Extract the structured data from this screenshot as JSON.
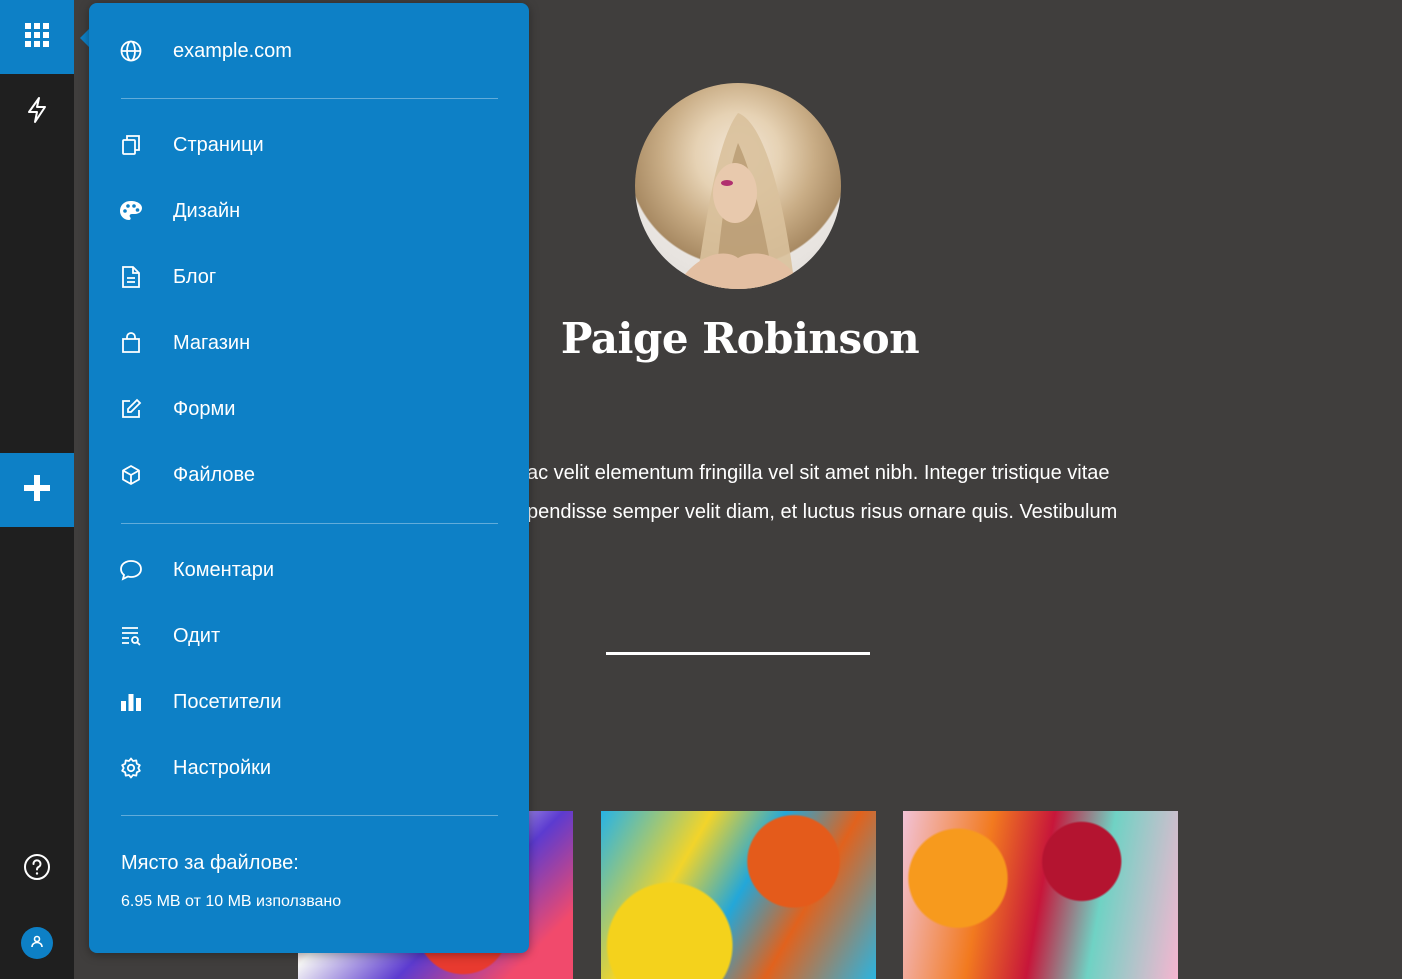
{
  "menu": {
    "site": "example.com",
    "items_group1": [
      {
        "label": "Страници",
        "icon": "pages-icon"
      },
      {
        "label": "Дизайн",
        "icon": "palette-icon"
      },
      {
        "label": "Блог",
        "icon": "document-icon"
      },
      {
        "label": "Магазин",
        "icon": "shopping-bag-icon"
      },
      {
        "label": "Форми",
        "icon": "edit-form-icon"
      },
      {
        "label": "Файлове",
        "icon": "cube-icon"
      }
    ],
    "items_group2": [
      {
        "label": "Коментари",
        "icon": "comment-icon"
      },
      {
        "label": "Одит",
        "icon": "audit-icon"
      },
      {
        "label": "Посетители",
        "icon": "bar-chart-icon"
      },
      {
        "label": "Настройки",
        "icon": "gear-icon"
      }
    ],
    "storage": {
      "title": "Място за файлове:",
      "usage": "6.95 MB от 10 MB използвано",
      "used_mb": 6.95,
      "total_mb": 10
    }
  },
  "rail": {
    "apps": "grid-icon",
    "flash": "lightning-icon",
    "add": "plus-icon",
    "help": "help-icon",
    "user": "user-icon"
  },
  "page": {
    "name": "Paige Robinson",
    "bio_line1": "ac velit elementum fringilla vel sit amet nibh. Integer tristique vitae",
    "bio_line2": "pendisse semper velit diam, et luctus risus ornare quis. Vestibulum"
  },
  "colors": {
    "accent": "#0d80c6",
    "rail": "#1f1f1f",
    "background": "#403e3d"
  }
}
